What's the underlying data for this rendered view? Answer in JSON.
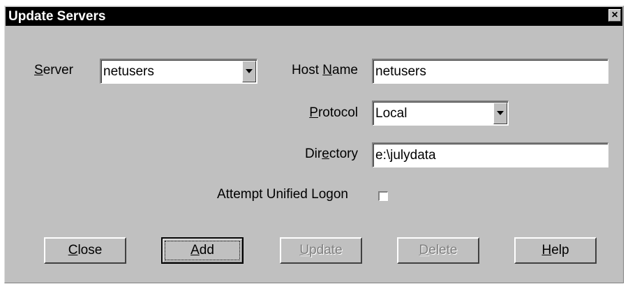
{
  "dialog": {
    "title": "Update Servers",
    "close_glyph": "×"
  },
  "server": {
    "label_mnemonic": "S",
    "label_rest": "erver",
    "value": "netusers"
  },
  "host_name": {
    "label_before": "Host ",
    "label_mnemonic": "N",
    "label_rest": "ame",
    "value": "netusers"
  },
  "protocol": {
    "label_mnemonic": "P",
    "label_rest": "rotocol",
    "value": "Local"
  },
  "directory": {
    "label_before": "Dir",
    "label_mnemonic": "e",
    "label_rest": "ctory",
    "value": "e:\\julydata"
  },
  "unified_logon": {
    "label": "Attempt Unified Logon",
    "checked": false
  },
  "buttons": {
    "close": {
      "mnemonic": "C",
      "rest": "lose",
      "enabled": true
    },
    "add": {
      "mnemonic": "A",
      "rest": "dd",
      "enabled": true,
      "default": true
    },
    "update": {
      "mnemonic": "U",
      "rest": "pdate",
      "enabled": false
    },
    "delete": {
      "mnemonic": "D",
      "rest": "elete",
      "enabled": false
    },
    "help": {
      "mnemonic": "H",
      "rest": "elp",
      "enabled": true
    }
  },
  "colors": {
    "face": "#c0c0c0",
    "titlebar": "#000000",
    "disabled_text": "#808080"
  }
}
